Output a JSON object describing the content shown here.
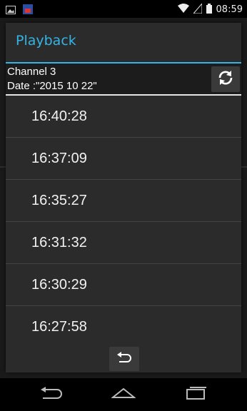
{
  "status_bar": {
    "time": "08:59",
    "icons": [
      "image-icon",
      "app-notification-icon",
      "wifi-icon",
      "signal-icon",
      "battery-icon"
    ]
  },
  "dialog": {
    "title": "Playback",
    "channel": "Channel 3",
    "date": "Date :\"2015 10 22\"",
    "accent_color": "#33b5e5",
    "times": [
      "16:40:28",
      "16:37:09",
      "16:35:27",
      "16:31:32",
      "16:30:29",
      "16:27:58"
    ]
  },
  "nav_bar": {
    "icons": [
      "back-icon",
      "home-icon",
      "recents-icon"
    ]
  }
}
